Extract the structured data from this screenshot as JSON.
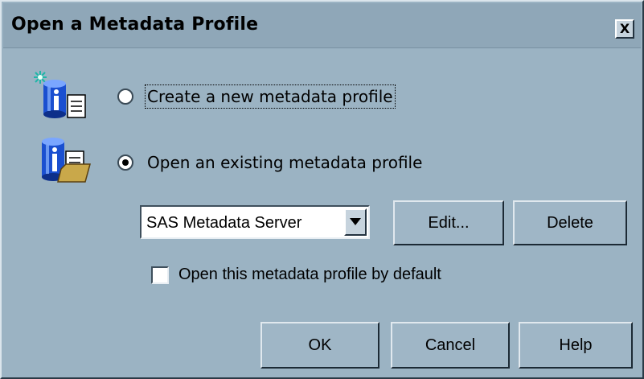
{
  "dialog": {
    "title": "Open a Metadata Profile",
    "close_label": "X"
  },
  "options": {
    "create_label": "Create a new metadata profile",
    "open_label": "Open an existing metadata profile",
    "selected": "open"
  },
  "profile_select": {
    "value": "SAS Metadata Server"
  },
  "buttons": {
    "edit": "Edit...",
    "delete": "Delete",
    "ok": "OK",
    "cancel": "Cancel",
    "help": "Help"
  },
  "default_checkbox": {
    "label": "Open this metadata profile by default",
    "checked": false
  },
  "icons": {
    "create": "new-metadata-profile-icon",
    "open": "open-metadata-profile-icon"
  },
  "colors": {
    "dialog_background": "#9bb3c3",
    "titlebar_background": "#8fa7b8",
    "icon_blue": "#1a4fd0"
  }
}
